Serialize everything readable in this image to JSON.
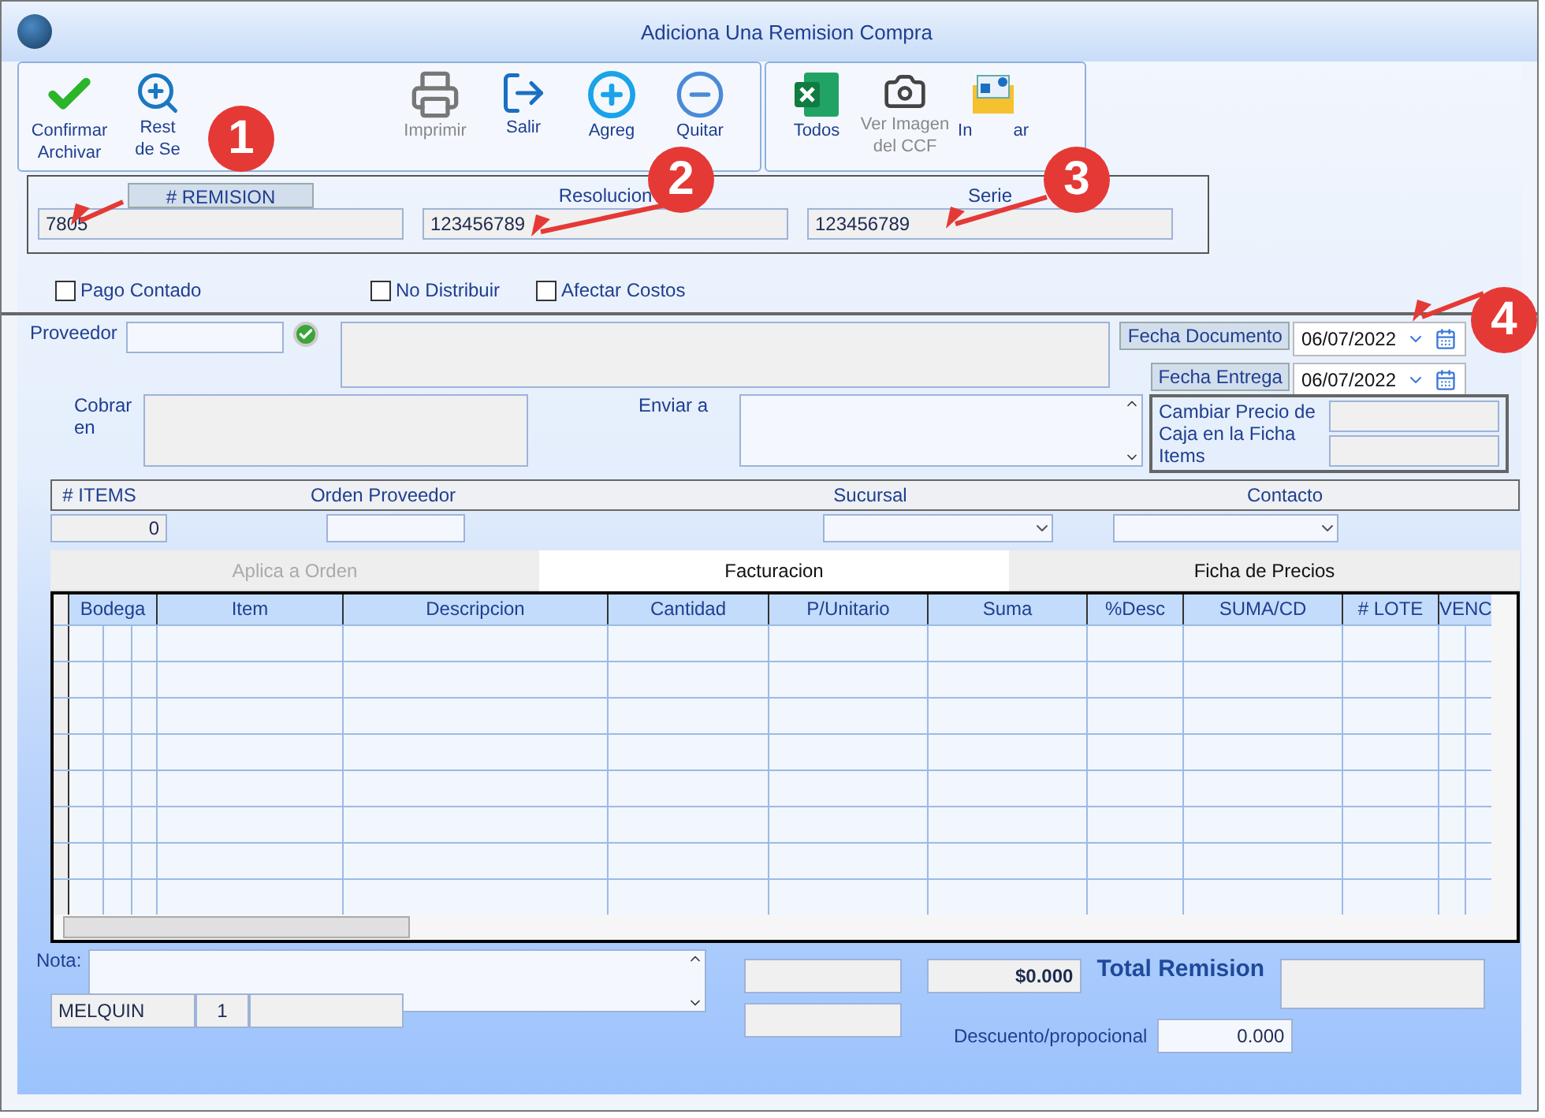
{
  "window": {
    "title": "Adiciona Una Remision Compra"
  },
  "toolbar": [
    {
      "kind": "check",
      "lines": [
        "Confirmar",
        "Archivar"
      ],
      "disabled": false
    },
    {
      "kind": "zoom",
      "lines": [
        "Rest",
        "de Se"
      ],
      "disabled": false
    },
    {
      "kind": "print",
      "lines": [
        "Imprimir"
      ],
      "disabled": true
    },
    {
      "kind": "exit",
      "lines": [
        "Salir"
      ],
      "disabled": false
    },
    {
      "kind": "plus",
      "lines": [
        "Agreg"
      ],
      "disabled": false
    },
    {
      "kind": "minus",
      "lines": [
        "Quitar"
      ],
      "disabled": false
    },
    {
      "kind": "excel",
      "lines": [
        "Todos"
      ],
      "disabled": false
    },
    {
      "kind": "camera",
      "lines": [
        "Ver Imagen",
        "del CCF"
      ],
      "disabled": true
    },
    {
      "kind": "card",
      "lines": [
        "In",
        "ar"
      ],
      "disabled": false
    }
  ],
  "header": [
    {
      "label": "# REMISION",
      "value": "7805",
      "boxed": true
    },
    {
      "label": "Resolucion",
      "value": "123456789",
      "boxed": false
    },
    {
      "label": "Serie",
      "value": "123456789",
      "boxed": false
    }
  ],
  "options": [
    {
      "label": "Pago Contado",
      "checked": false
    },
    {
      "label": "No Distribuir",
      "checked": false
    },
    {
      "label": "Afectar Costos",
      "checked": false
    }
  ],
  "proveedor": {
    "label": "Proveedor"
  },
  "cobrar": {
    "label": "Cobrar en"
  },
  "enviar": {
    "label": "Enviar a"
  },
  "dates": [
    {
      "label": "Fecha Documento",
      "value": "06/07/2022"
    },
    {
      "label": "Fecha Entrega",
      "value": "06/07/2022"
    }
  ],
  "cambiar": {
    "label": "Cambiar Precio de Caja en la Ficha Items"
  },
  "info_columns": [
    "# ITEMS",
    "Orden Proveedor",
    "Sucursal",
    "Contacto"
  ],
  "items_count": "0",
  "tabs": [
    {
      "label": "Aplica a Orden",
      "selected": false,
      "disabled": true
    },
    {
      "label": "Facturacion",
      "selected": true,
      "disabled": false
    },
    {
      "label": "Ficha de Precios",
      "selected": false,
      "disabled": false
    }
  ],
  "table": {
    "columns": [
      "Bodega",
      "Item",
      "Descripcion",
      "Cantidad",
      "P/Unitario",
      "Suma",
      "%Desc",
      "SUMA/CD",
      "# LOTE",
      "VENC"
    ]
  },
  "nota": {
    "label": "Nota:"
  },
  "user": {
    "name": "MELQUIN",
    "number": "1"
  },
  "totals": {
    "amount": "$0.000",
    "total_label": "Total Remision",
    "discount_label": "Descuento/propocional",
    "discount": "0.000"
  },
  "annotations": [
    "1",
    "2",
    "3",
    "4"
  ]
}
